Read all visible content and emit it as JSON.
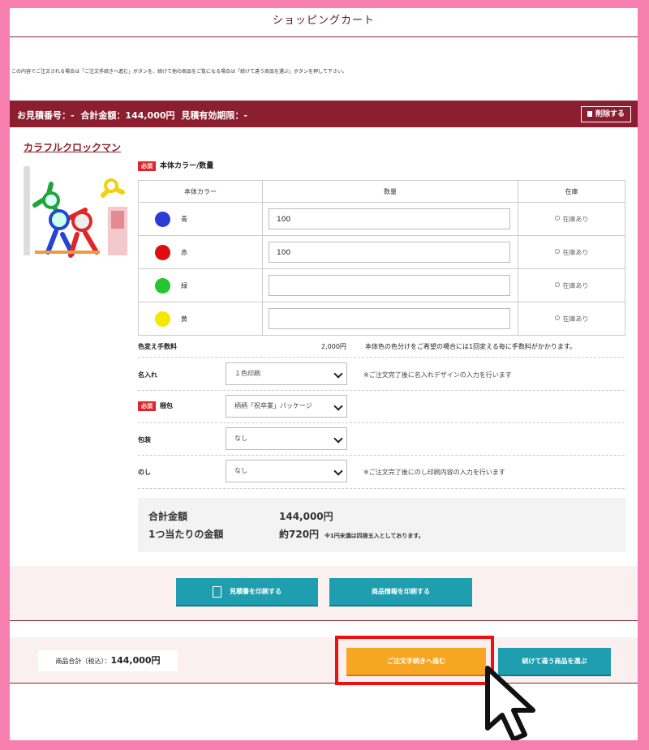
{
  "page": {
    "title": "ショッピングカート",
    "notice": "この内容でご注文される場合は「ご注文手続きへ進む」ボタンを、続けて他の商品をご覧になる場合は「続けて違う商品を選ぶ」ボタンを押して下さい。"
  },
  "quote": {
    "number": "お見積番号：-",
    "total": "合計金額：144,000円",
    "expiry": "見積有効期限：-",
    "delete_label": "削除する"
  },
  "product": {
    "name": "カラフルクロックマン",
    "required_badge": "必須",
    "option_title": "本体カラー/数量",
    "table_headers": [
      "本体カラー",
      "数量",
      "在庫"
    ],
    "colors": [
      {
        "name": "青",
        "swatch": "#2a3bd6",
        "qty": "100",
        "stock": "在庫あり"
      },
      {
        "name": "赤",
        "swatch": "#e00d0d",
        "qty": "100",
        "stock": "在庫あり"
      },
      {
        "name": "緑",
        "swatch": "#25c52e",
        "qty": "",
        "stock": "在庫あり"
      },
      {
        "name": "黄",
        "swatch": "#f5e800",
        "qty": "",
        "stock": "在庫あり"
      }
    ]
  },
  "options": {
    "color_change": {
      "label": "色変え手数料",
      "price": "2,000円",
      "note": "本体色の色分けをご希望の場合には1回変える毎に手数料がかかります。"
    },
    "naire": {
      "label": "名入れ",
      "value": "１色印刷",
      "note": "※ご注文完了後に名入れデザインの入力を行います"
    },
    "konpo": {
      "label": "梱包",
      "required_badge": "必須",
      "value": "柄柄「祝卒業」パッケージ"
    },
    "hoso": {
      "label": "包装",
      "value": "なし"
    },
    "noshi": {
      "label": "のし",
      "value": "なし",
      "note": "※ご注文完了後にのし印刷内容の入力を行います"
    }
  },
  "price": {
    "total_label": "合計金額",
    "total_value": "144,000円",
    "unit_label": "1つ当たりの金額",
    "unit_value": "約720円",
    "unit_note": "※1円未満は四捨五入としております。"
  },
  "buttons": {
    "print_estimate": "見積書を印刷する",
    "print_product": "商品情報を印刷する",
    "order": "ご注文手続きへ進む",
    "continue": "続けて違う商品を選ぶ"
  },
  "subtotal": {
    "label": "商品合計（税込）：",
    "value": "144,000円"
  },
  "colors": {
    "frame": "#f77fb0",
    "brand": "#8b1f2f",
    "teal": "#1f9eaf",
    "orange": "#f6a623",
    "highlight": "#e11111"
  }
}
